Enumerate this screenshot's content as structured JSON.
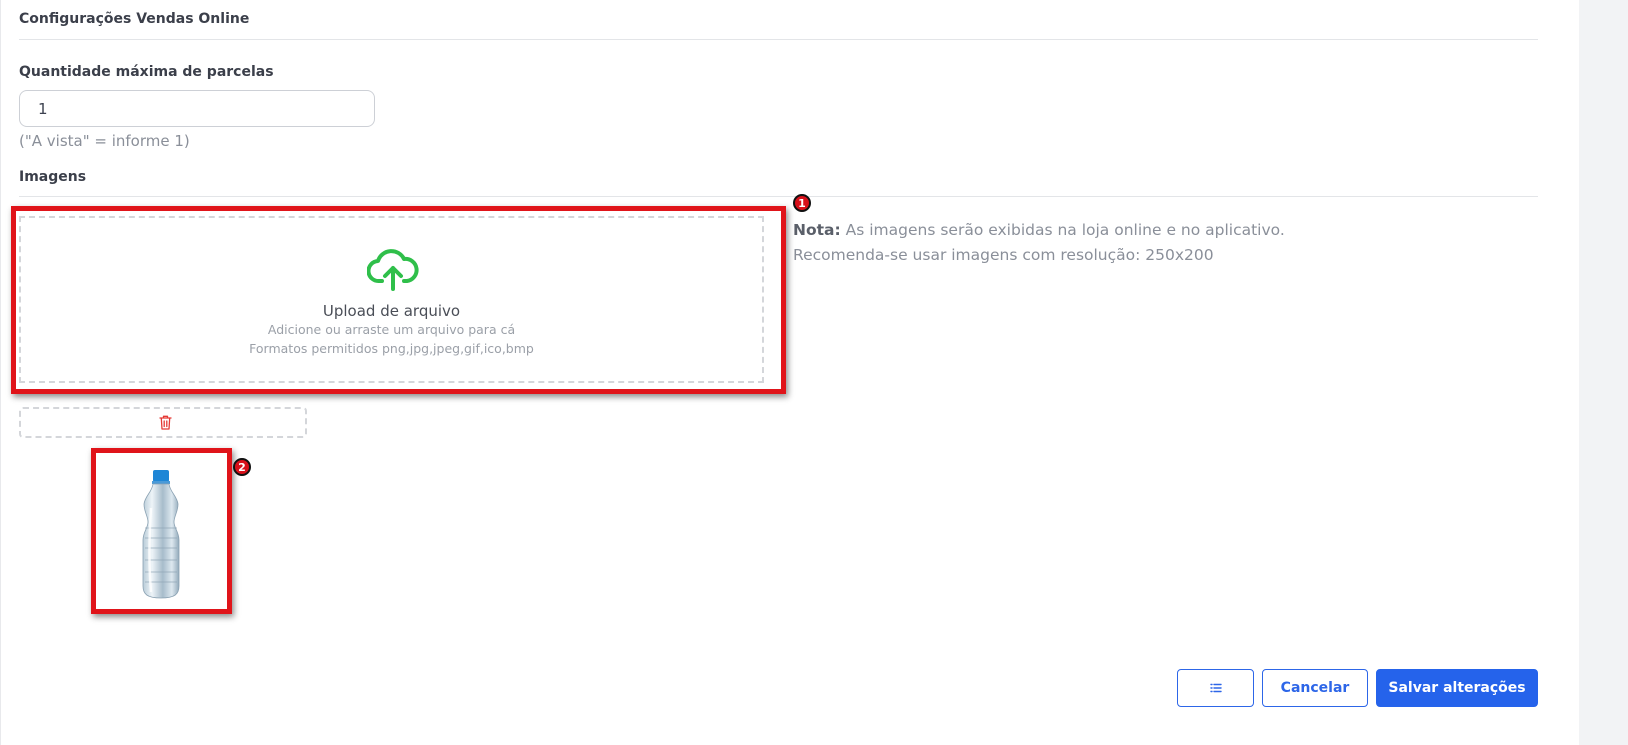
{
  "section": {
    "title": "Configurações Vendas Online"
  },
  "installments": {
    "label": "Quantidade máxima de parcelas",
    "value": "1",
    "hint": "(\"A vista\" = informe 1)"
  },
  "images": {
    "label": "Imagens",
    "upload": {
      "title": "Upload de arquivo",
      "subtitle": "Adicione ou arraste um arquivo para cá",
      "formats": "Formatos permitidos png,jpg,jpeg,gif,ico,bmp",
      "icon": "cloud-upload-icon"
    },
    "note": {
      "prefix": "Nota:",
      "line1": " As imagens serão exibidas na loja online e no aplicativo.",
      "line2": "Recomenda-se usar imagens com resolução: 250x200"
    },
    "delete_icon": "trash-icon",
    "product_image": "water-bottle"
  },
  "annotations": [
    {
      "number": "1"
    },
    {
      "number": "2"
    }
  ],
  "footer": {
    "list_icon": "list-icon",
    "cancel_label": "Cancelar",
    "save_label": "Salvar alterações"
  },
  "colors": {
    "primary": "#2563eb",
    "upload_icon": "#2fbf4a",
    "annotation": "#e0141a",
    "delete": "#e53935"
  }
}
